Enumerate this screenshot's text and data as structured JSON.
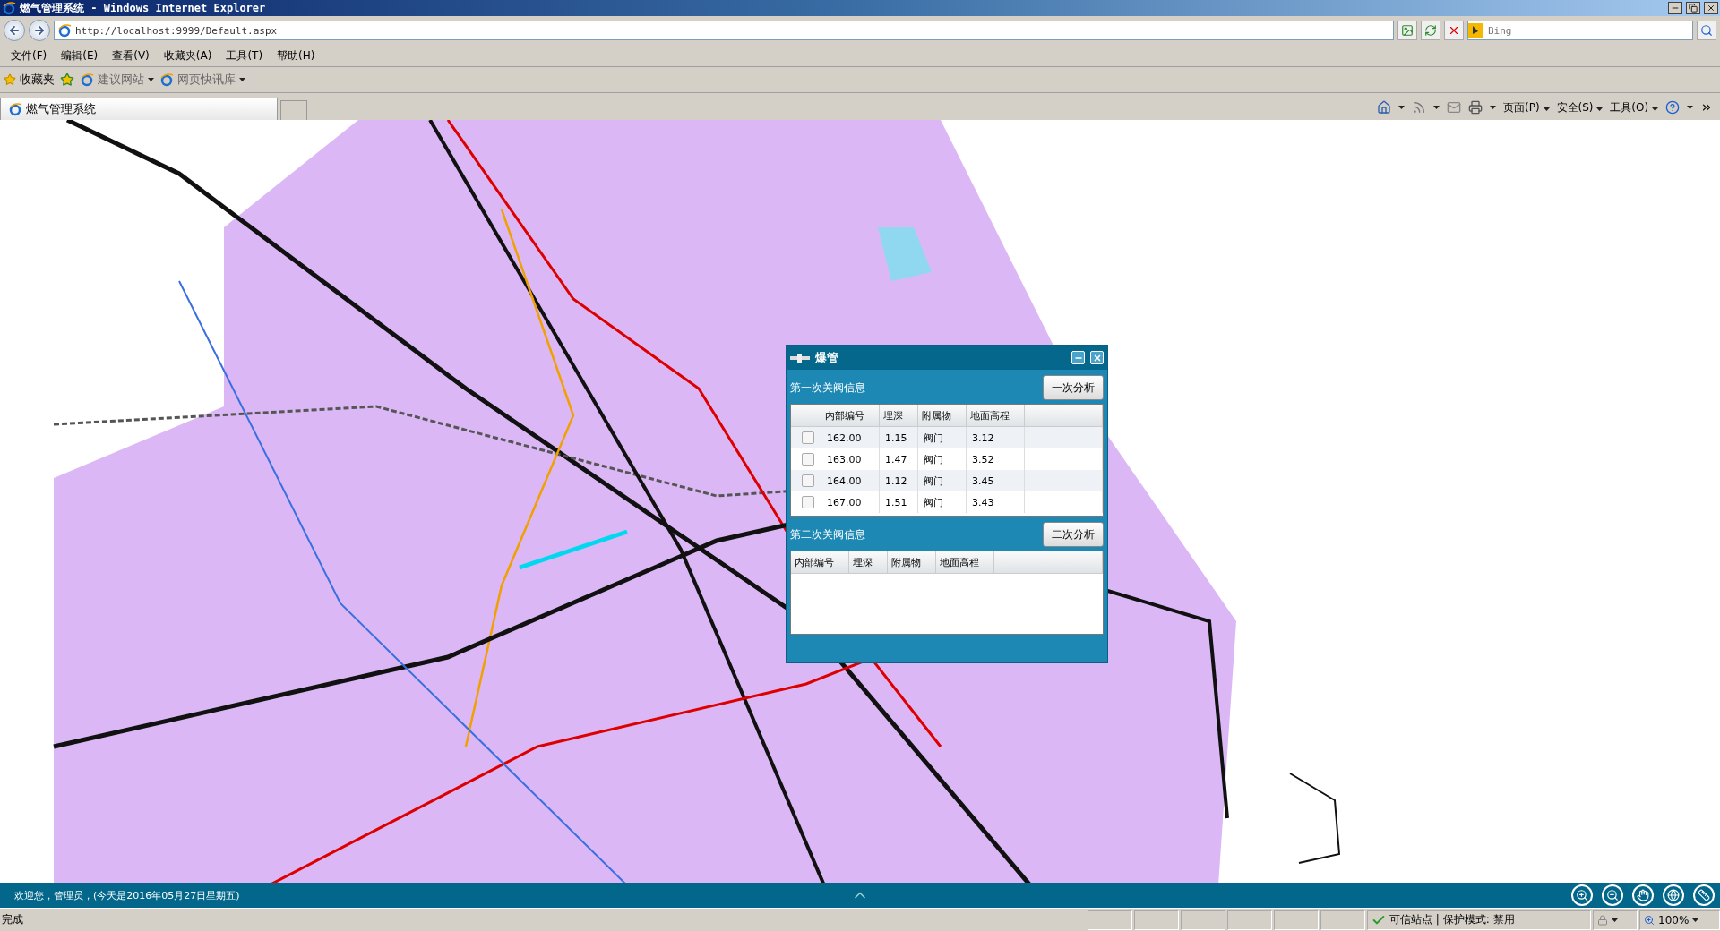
{
  "window": {
    "title": "燃气管理系统 - Windows Internet Explorer"
  },
  "address_bar": {
    "url": "http://localhost:9999/Default.aspx"
  },
  "search": {
    "placeholder": "Bing"
  },
  "menu": [
    "文件(F)",
    "编辑(E)",
    "查看(V)",
    "收藏夹(A)",
    "工具(T)",
    "帮助(H)"
  ],
  "favorites_bar": {
    "label": "收藏夹",
    "links": [
      "建议网站",
      "网页快讯库"
    ]
  },
  "tab": {
    "title": "燃气管理系统"
  },
  "command_bar": [
    "页面(P)",
    "安全(S)",
    "工具(O)"
  ],
  "map": {
    "kind": "picture"
  },
  "dialog": {
    "title": "爆管",
    "first": {
      "heading": "第一次关阀信息",
      "button": "一次分析",
      "columns": [
        "内部编号",
        "埋深",
        "附属物",
        "地面高程"
      ],
      "rows": [
        {
          "cells": [
            "162.00",
            "1.15",
            "阀门",
            "3.12"
          ],
          "checked": false
        },
        {
          "cells": [
            "163.00",
            "1.47",
            "阀门",
            "3.52"
          ],
          "checked": false
        },
        {
          "cells": [
            "164.00",
            "1.12",
            "阀门",
            "3.45"
          ],
          "checked": false
        },
        {
          "cells": [
            "167.00",
            "1.51",
            "阀门",
            "3.43"
          ],
          "checked": false
        }
      ]
    },
    "second": {
      "heading": "第二次关阀信息",
      "button": "二次分析",
      "columns": [
        "内部编号",
        "埋深",
        "附属物",
        "地面高程"
      ]
    }
  },
  "footer": {
    "welcome": "欢迎您，管理员，(今天是2016年05月27日星期五)"
  },
  "status_bar": {
    "status": "完成",
    "zone": "可信站点 | 保护模式: 禁用",
    "zoom": "100%"
  }
}
